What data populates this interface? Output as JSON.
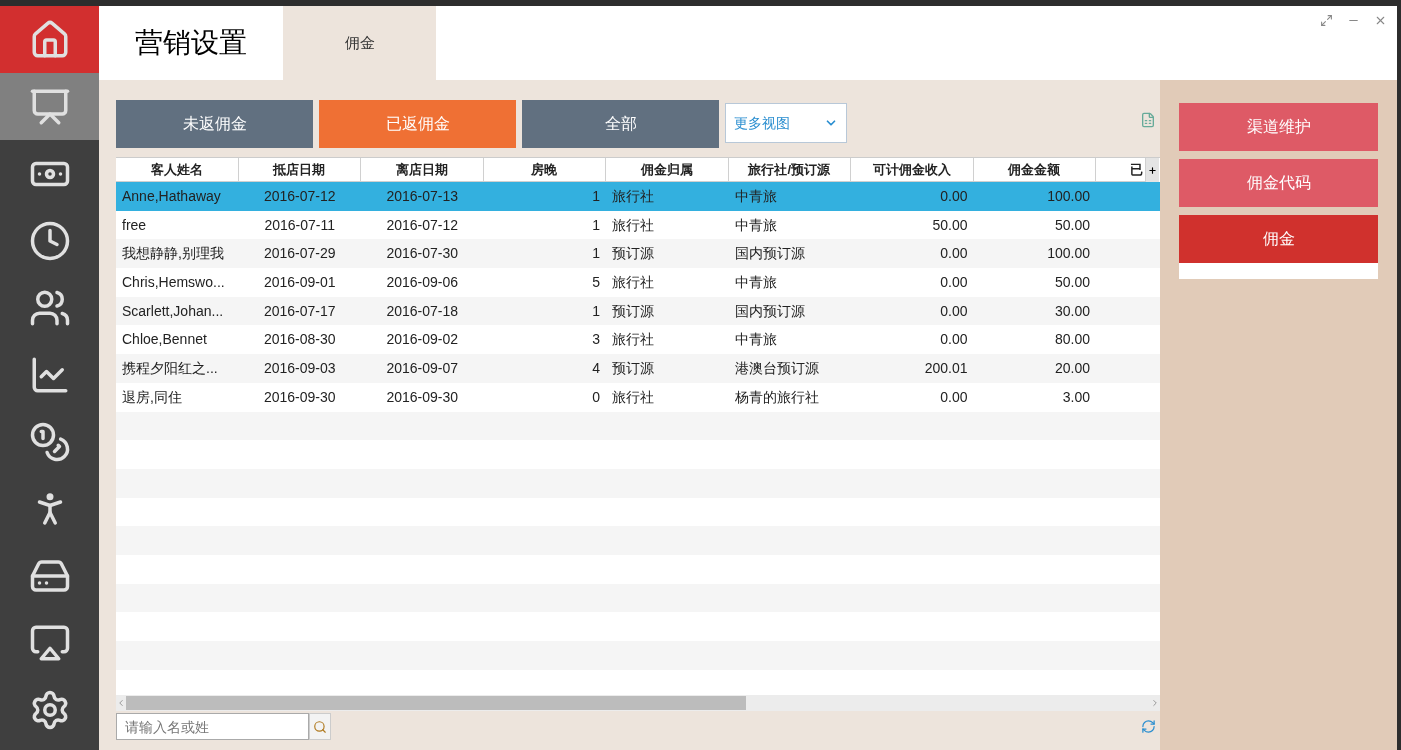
{
  "sidebar": {
    "items": [
      {
        "kind": "home"
      },
      {
        "kind": "presentation",
        "selected": true
      },
      {
        "kind": "money",
        "selected": false
      },
      {
        "kind": "clock",
        "selected": false
      },
      {
        "kind": "users",
        "selected": false
      },
      {
        "kind": "chart",
        "selected": false
      },
      {
        "kind": "coins",
        "selected": false
      },
      {
        "kind": "person",
        "selected": false
      },
      {
        "kind": "drive",
        "selected": false
      },
      {
        "kind": "cast",
        "selected": false
      },
      {
        "kind": "settings",
        "selected": false
      }
    ]
  },
  "header": {
    "title": "营销设置",
    "tabs": [
      {
        "label": "佣金",
        "selected": true
      }
    ]
  },
  "filters": [
    {
      "label": "未返佣金",
      "selected": false
    },
    {
      "label": "已返佣金",
      "selected": true
    },
    {
      "label": "全部",
      "selected": false
    }
  ],
  "view_select": {
    "value": "更多视图"
  },
  "table": {
    "columns": [
      "客人姓名",
      "抵店日期",
      "离店日期",
      "房晚",
      "佣金归属",
      "旅行社/预订源",
      "可计佣金收入",
      "佣金金额",
      "已"
    ],
    "rows": [
      {
        "selected": true,
        "cells": [
          "Anne,Hathaway",
          "2016-07-12",
          "2016-07-13",
          "1",
          "旅行社",
          "中青旅",
          "0.00",
          "100.00"
        ]
      },
      {
        "selected": false,
        "cells": [
          "free",
          "2016-07-11",
          "2016-07-12",
          "1",
          "旅行社",
          "中青旅",
          "50.00",
          "50.00"
        ]
      },
      {
        "selected": false,
        "cells": [
          "我想静静,别理我",
          "2016-07-29",
          "2016-07-30",
          "1",
          "预订源",
          "国内预订源",
          "0.00",
          "100.00"
        ]
      },
      {
        "selected": false,
        "cells": [
          "Chris,Hemswo...",
          "2016-09-01",
          "2016-09-06",
          "5",
          "旅行社",
          "中青旅",
          "0.00",
          "50.00"
        ]
      },
      {
        "selected": false,
        "cells": [
          "Scarlett,Johan...",
          "2016-07-17",
          "2016-07-18",
          "1",
          "预订源",
          "国内预订源",
          "0.00",
          "30.00"
        ]
      },
      {
        "selected": false,
        "cells": [
          "Chloe,Bennet",
          "2016-08-30",
          "2016-09-02",
          "3",
          "旅行社",
          "中青旅",
          "0.00",
          "80.00"
        ]
      },
      {
        "selected": false,
        "cells": [
          "携程夕阳红之...",
          "2016-09-03",
          "2016-09-07",
          "4",
          "预订源",
          "港澳台预订源",
          "200.01",
          "20.00"
        ]
      },
      {
        "selected": false,
        "cells": [
          "退房,同住",
          "2016-09-30",
          "2016-09-30",
          "0",
          "旅行社",
          "杨青的旅行社",
          "0.00",
          "3.00"
        ]
      }
    ]
  },
  "search": {
    "placeholder": "请输入名或姓"
  },
  "side_menu": [
    {
      "label": "渠道维护",
      "selected": false
    },
    {
      "label": "佣金代码",
      "selected": false
    },
    {
      "label": "佣金",
      "selected": true
    }
  ]
}
